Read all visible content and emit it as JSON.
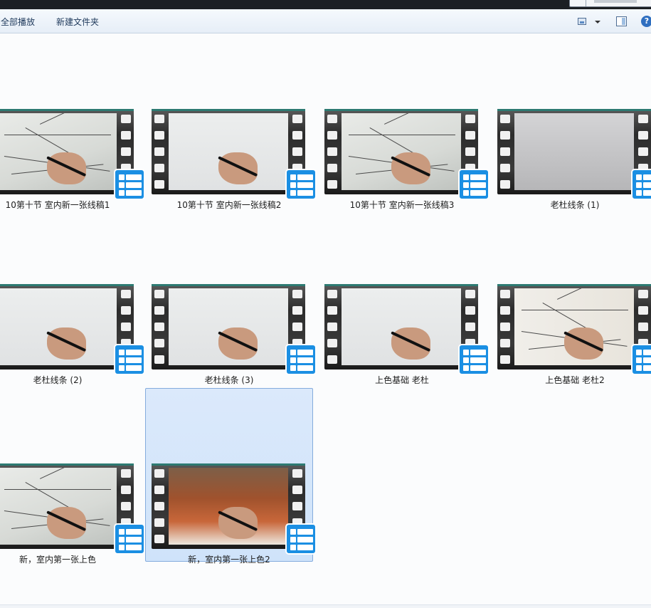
{
  "toolbar": {
    "play_all": "全部播放",
    "new_folder": "新建文件夹",
    "help": "?"
  },
  "icons": {
    "view": "view-options-icon",
    "pane": "preview-pane-icon",
    "help": "help-icon",
    "badge": "video-file-icon"
  },
  "colors": {
    "selection": "#cfe3fa",
    "badge": "#1b8fe3"
  },
  "files": [
    {
      "name": "10第十节 室内新一张线稿1",
      "selected": false
    },
    {
      "name": "10第十节 室内新一张线稿2",
      "selected": false
    },
    {
      "name": "10第十节 室内新一张线稿3",
      "selected": false
    },
    {
      "name": "老杜线条 (1)",
      "selected": false
    },
    {
      "name": "老杜线条 (2)",
      "selected": false
    },
    {
      "name": "老杜线条 (3)",
      "selected": false
    },
    {
      "name": "上色基础 老杜",
      "selected": false
    },
    {
      "name": "上色基础 老杜2",
      "selected": false
    },
    {
      "name": "新，室内第一张上色",
      "selected": false
    },
    {
      "name": "新，室内第一张上色2",
      "selected": true
    }
  ]
}
